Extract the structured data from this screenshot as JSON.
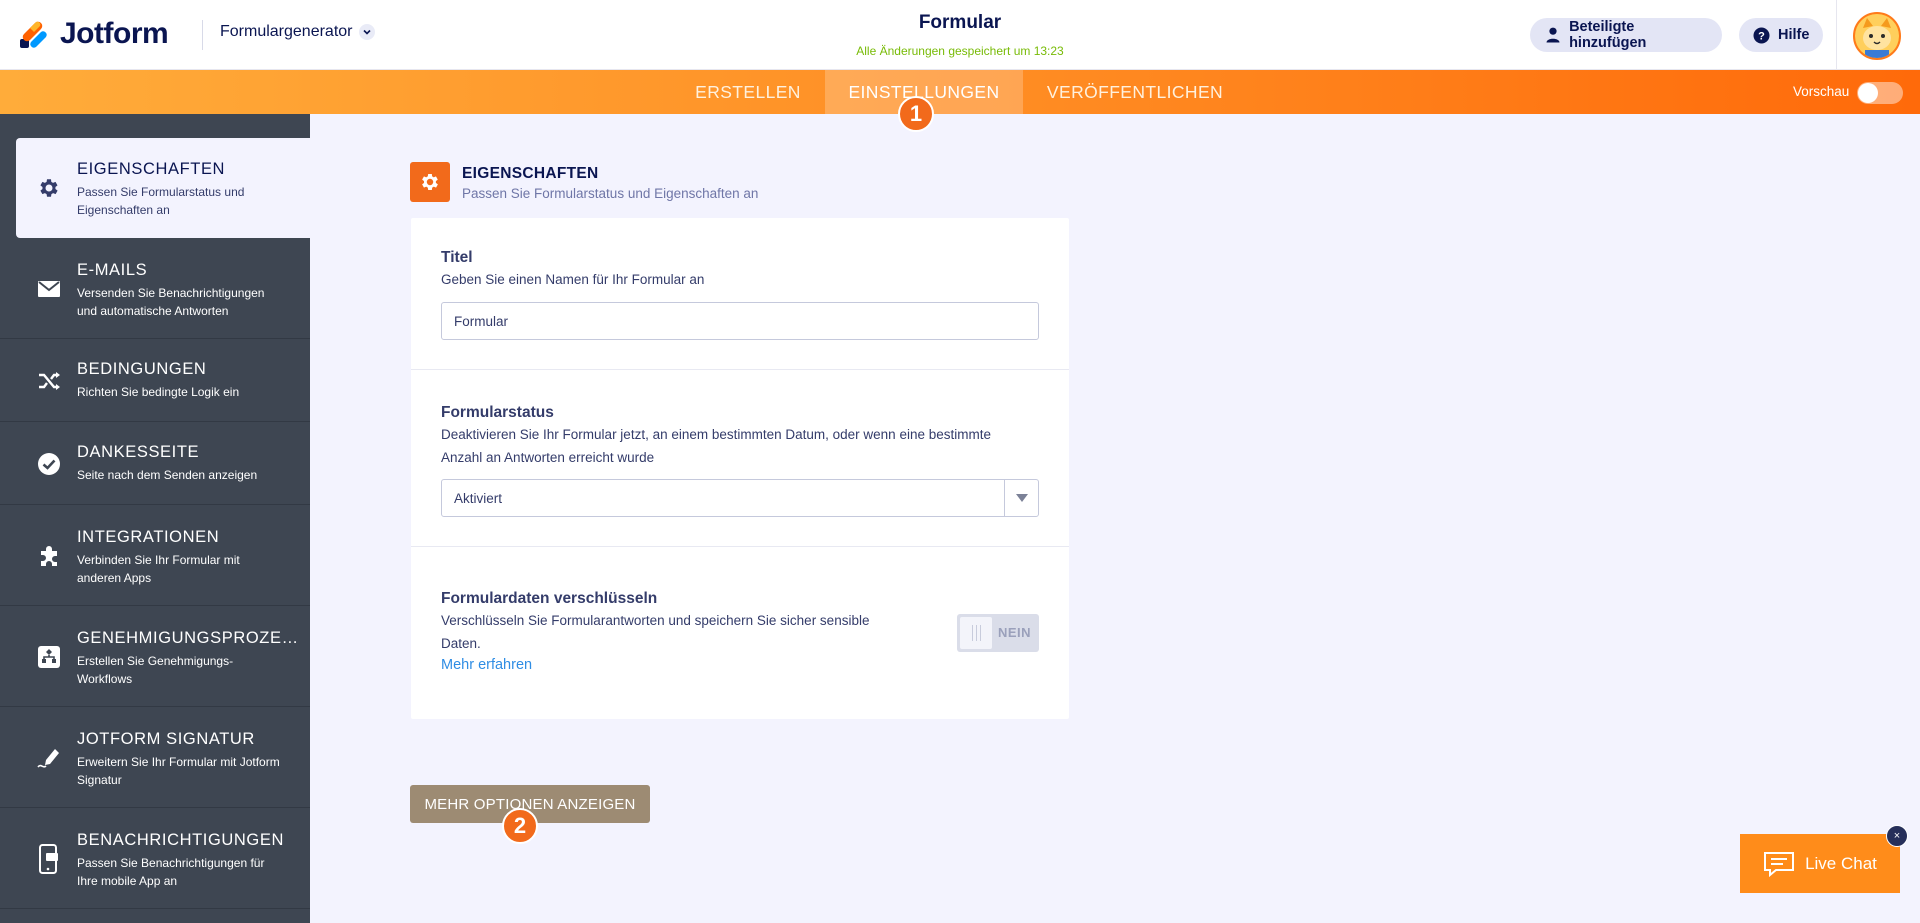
{
  "app": {
    "logo_text": "Jotform",
    "product": "Formulargenerator"
  },
  "header": {
    "form_title": "Formular",
    "save_status": "Alle Änderungen gespeichert um 13:23",
    "collab_label": "Beteiligte hinzufügen",
    "help_label": "Hilfe"
  },
  "nav": {
    "tabs": [
      {
        "label": "ERSTELLEN"
      },
      {
        "label": "EINSTELLUNGEN",
        "active": true
      },
      {
        "label": "VERÖFFENTLICHEN"
      }
    ],
    "preview_label": "Vorschau",
    "preview_on": false
  },
  "annotations": {
    "one": "1",
    "two": "2"
  },
  "sidebar": {
    "items": [
      {
        "title": "EIGENSCHAFTEN",
        "desc": "Passen Sie Formularstatus und Eigenschaften an",
        "icon": "gear-icon",
        "active": true
      },
      {
        "title": "E-MAILS",
        "desc": "Versenden Sie Benachrichtigungen und automatische Antworten",
        "icon": "envelope-icon"
      },
      {
        "title": "BEDINGUNGEN",
        "desc": "Richten Sie bedingte Logik ein",
        "icon": "shuffle-icon"
      },
      {
        "title": "DANKESSEITE",
        "desc": "Seite nach dem Senden anzeigen",
        "icon": "check-circle-icon"
      },
      {
        "title": "INTEGRATIONEN",
        "desc": "Verbinden Sie Ihr Formular mit anderen Apps",
        "icon": "puzzle-icon"
      },
      {
        "title": "GENEHMIGUNGSPROZESSE",
        "desc": "Erstellen Sie Genehmigungs-Workflows",
        "icon": "workflow-icon"
      },
      {
        "title": "JOTFORM SIGNATUR",
        "desc": "Erweitern Sie Ihr Formular mit Jotform Signatur",
        "icon": "signature-pen-icon"
      },
      {
        "title": "BENACHRICHTIGUNGEN",
        "desc": "Passen Sie Benachrichtigungen für Ihre mobile App an",
        "icon": "mobile-notification-icon"
      }
    ]
  },
  "section": {
    "title": "EIGENSCHAFTEN",
    "desc": "Passen Sie Formularstatus und Eigenschaften an"
  },
  "fields": {
    "title": {
      "label": "Titel",
      "desc": "Geben Sie einen Namen für Ihr Formular an",
      "value": "Formular"
    },
    "status": {
      "label": "Formularstatus",
      "desc": "Deaktivieren Sie Ihr Formular jetzt, an einem bestimmten Datum, oder wenn eine bestimmte Anzahl an Antworten erreicht wurde",
      "value": "Aktiviert"
    },
    "encrypt": {
      "label": "Formulardaten verschlüsseln",
      "desc": "Verschlüsseln Sie Formularantworten und speichern Sie sicher sensible Daten.",
      "link": "Mehr erfahren",
      "toggle_label": "NEIN",
      "enabled": false
    }
  },
  "more_options_label": "MEHR OPTIONEN ANZEIGEN",
  "live_chat": {
    "label": "Live Chat",
    "close": "×"
  },
  "colors": {
    "accent": "#f26a1b",
    "sidebar": "#3e4652",
    "link": "#2f8de4",
    "saved": "#78bb07"
  }
}
